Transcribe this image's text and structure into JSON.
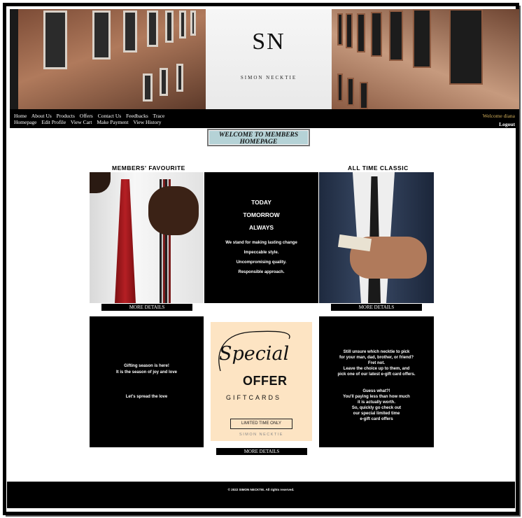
{
  "brand": {
    "monogram": "SN",
    "name": "SIMON NECKTIE"
  },
  "nav": {
    "row1": [
      "Home",
      "About Us",
      "Products",
      "Offers",
      "Contact Us",
      "Feedbacks",
      "Trace"
    ],
    "row2": [
      "Homepage",
      "Edit Profile",
      "View Cart",
      "Make Payment",
      "View History"
    ],
    "welcome": "Welcome diana",
    "logout": "Logout"
  },
  "main": {
    "welcome_title": "WELCOME TO MEMBERS HOMEPAGE",
    "section_left": "MEMBERS' FAVOURITE",
    "section_right": "ALL TIME CLASSIC",
    "more_details": "MORE DETAILS",
    "mid_panel": {
      "lines": [
        "TODAY",
        "TOMORROW",
        "ALWAYS"
      ],
      "body": [
        "We stand for making lasting change",
        "Impeccable style.",
        "Uncompromising quality.",
        "Responsible approach."
      ]
    },
    "gift_panel": {
      "line1": "Gifting season is here!",
      "line2": "It is the season of joy and love",
      "line3": "Let's spread the love"
    },
    "offer": {
      "script": "Special",
      "big": "OFFER",
      "sub": "GIFTCARDS",
      "button": "LIMITED TIME ONLY",
      "brand": "SIMON NECKTIE"
    },
    "right_panel": {
      "para1": [
        "Still unsure which necktie to pick",
        "for your man, dad, brother, or friend?",
        "Fret not.",
        "Leave the choice up to them, and",
        "pick one of our latest e-gift card offers."
      ],
      "para2": [
        "Guess what?!",
        "You'll paying less than how much",
        "it is actually worth.",
        "So, quickly go check out",
        "our special limited time",
        "e-gift card offers"
      ]
    }
  },
  "footer": {
    "copyright": "© 2022 SIMON NECKTIE. All rights reserved."
  }
}
